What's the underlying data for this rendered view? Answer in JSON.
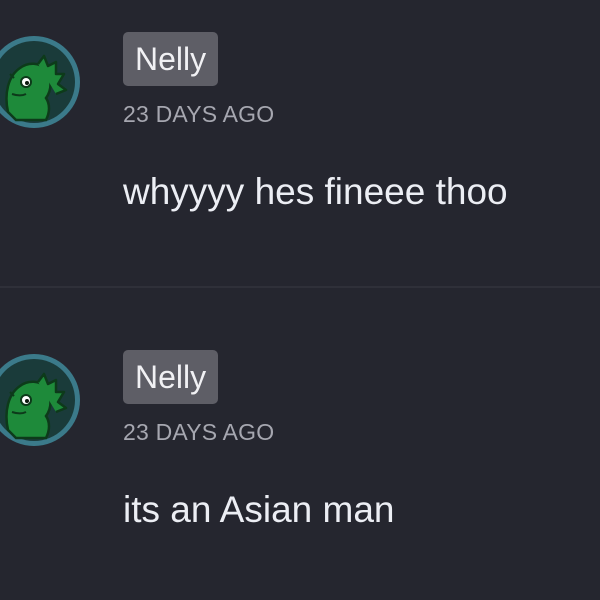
{
  "colors": {
    "background": "#25262f",
    "divider": "#2f3039",
    "name_badge": "#5e5e66",
    "timestamp": "#a6a7b0",
    "message_text": "#eceef4",
    "avatar_ring": "#3b7a8a",
    "avatar_dino": "#1e8a3a"
  },
  "messages": [
    {
      "author": "Nelly",
      "time": "23 DAYS AGO",
      "text": "whyyyy hes fineee thoo",
      "avatar_icon": "green-dinosaur-avatar"
    },
    {
      "author": "Nelly",
      "time": "23 DAYS AGO",
      "text": "its an Asian man",
      "avatar_icon": "green-dinosaur-avatar"
    }
  ]
}
